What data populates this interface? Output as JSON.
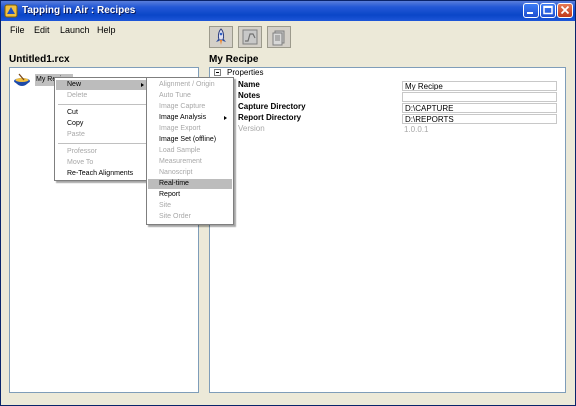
{
  "window": {
    "title": "Tapping in Air : Recipes"
  },
  "menubar": [
    "File",
    "Edit",
    "Launch",
    "Help"
  ],
  "toolbar": {
    "icons": [
      "launch-rocket-icon",
      "chart-icon",
      "document-icon"
    ]
  },
  "left_pane": {
    "title": "Untitled1.rcx",
    "tree_item": "My Recipe"
  },
  "context_menu": {
    "items": [
      {
        "label": "New",
        "enabled": true,
        "highlighted": true,
        "submenu": true
      },
      {
        "label": "Delete",
        "enabled": false
      },
      {
        "label": "Cut",
        "enabled": true
      },
      {
        "label": "Copy",
        "enabled": true
      },
      {
        "label": "Paste",
        "enabled": false
      },
      {
        "label": "Professor",
        "enabled": false
      },
      {
        "label": "Move To",
        "enabled": false
      },
      {
        "label": "Re-Teach Alignments",
        "enabled": true
      }
    ]
  },
  "submenu": {
    "items": [
      {
        "label": "Alignment / Origin",
        "enabled": false
      },
      {
        "label": "Auto Tune",
        "enabled": false
      },
      {
        "label": "Image Capture",
        "enabled": false
      },
      {
        "label": "Image Analysis",
        "enabled": true,
        "submenu": true
      },
      {
        "label": "Image Export",
        "enabled": false
      },
      {
        "label": "Image Set (offline)",
        "enabled": true
      },
      {
        "label": "Load Sample",
        "enabled": false
      },
      {
        "label": "Measurement",
        "enabled": false
      },
      {
        "label": "Nanoscript",
        "enabled": false
      },
      {
        "label": "Real-time",
        "enabled": true,
        "highlighted": true
      },
      {
        "label": "Report",
        "enabled": true
      },
      {
        "label": "Site",
        "enabled": false
      },
      {
        "label": "Site Order",
        "enabled": false
      }
    ]
  },
  "right_pane": {
    "title": "My Recipe",
    "properties_heading": "Properties",
    "properties": [
      {
        "name": "Name",
        "value": "My Recipe"
      },
      {
        "name": "Notes",
        "value": ""
      },
      {
        "name": "Capture Directory",
        "value": "D:\\CAPTURE"
      },
      {
        "name": "Report Directory",
        "value": "D:\\REPORTS"
      },
      {
        "name": "Version",
        "value": "1.0.0.1",
        "readonly": true
      }
    ]
  },
  "colors": {
    "titlebar": "#0a46c8",
    "menu_highlight": "#bcbcbc",
    "disabled_text": "#a8a8a8"
  }
}
